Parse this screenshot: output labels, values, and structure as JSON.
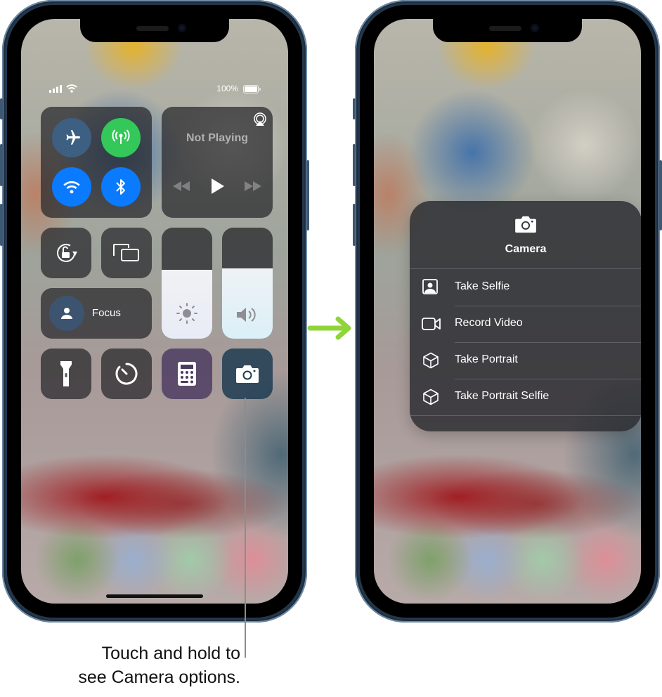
{
  "left_phone": {
    "status_bar": {
      "signal_icon": "cellular-signal-icon",
      "wifi_icon": "wifi-icon",
      "battery_percent": "100%",
      "battery_icon": "battery-full-icon"
    },
    "connectivity": [
      {
        "name": "airplane-mode",
        "icon": "airplane-icon",
        "state": "off",
        "color": "#3d5f82"
      },
      {
        "name": "cellular-data",
        "icon": "antenna-icon",
        "state": "on",
        "color": "#34c759"
      },
      {
        "name": "wifi",
        "icon": "wifi-icon",
        "state": "on",
        "color": "#0a7aff"
      },
      {
        "name": "bluetooth",
        "icon": "bluetooth-icon",
        "state": "on",
        "color": "#0a7aff"
      }
    ],
    "now_playing": {
      "title": "Not Playing",
      "airplay_icon": "airplay-audio-icon",
      "controls": [
        "rewind-icon",
        "play-icon",
        "fast-forward-icon"
      ]
    },
    "toggles": {
      "orientation_lock_icon": "orientation-lock-icon",
      "screen_mirroring_icon": "screen-mirroring-icon"
    },
    "focus": {
      "label": "Focus",
      "icon": "person-icon"
    },
    "brightness": {
      "icon": "sun-icon",
      "level": 0.62
    },
    "volume": {
      "icon": "speaker-icon",
      "level": 0.63
    },
    "bottom_row": [
      "flashlight-icon",
      "timer-icon",
      "calculator-icon",
      "camera-icon"
    ]
  },
  "right_phone": {
    "menu": {
      "icon": "camera-icon",
      "title": "Camera",
      "items": [
        {
          "label": "Take Selfie",
          "icon": "selfie-icon"
        },
        {
          "label": "Record Video",
          "icon": "video-camera-icon"
        },
        {
          "label": "Take Portrait",
          "icon": "cube-icon"
        },
        {
          "label": "Take Portrait Selfie",
          "icon": "cube-icon"
        }
      ]
    }
  },
  "arrow": {
    "color": "#8fd43a",
    "icon": "arrow-right-icon"
  },
  "caption": {
    "line1": "Touch and hold to",
    "line2": "see Camera options."
  }
}
